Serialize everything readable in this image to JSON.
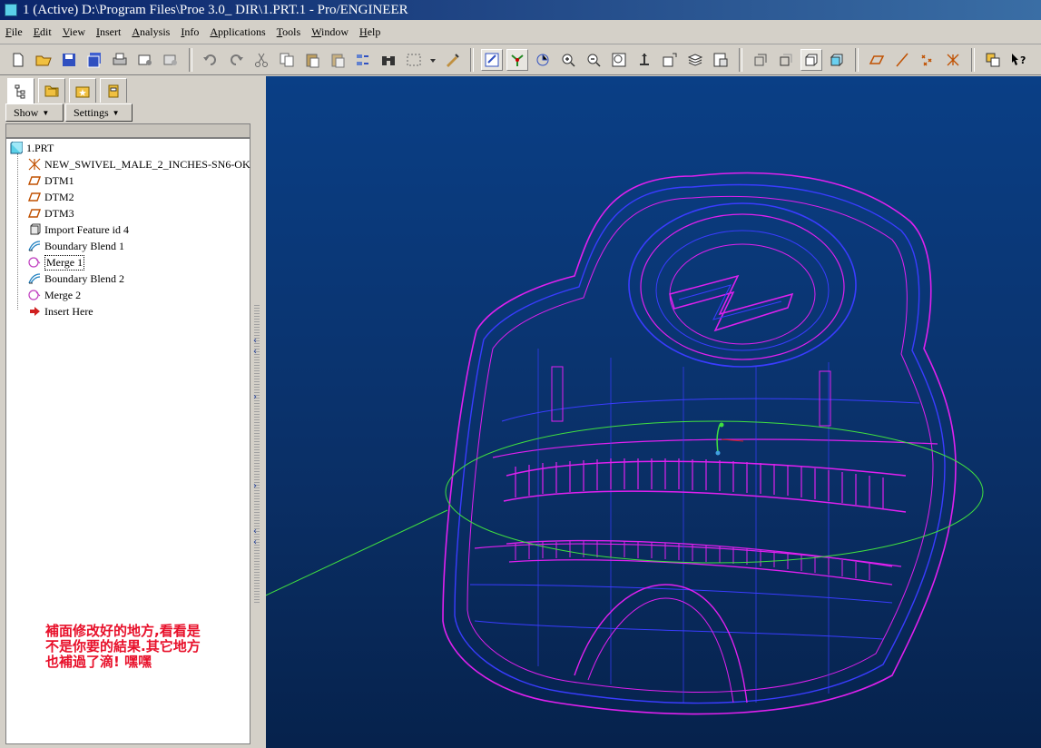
{
  "window": {
    "title": "1 (Active) D:\\Program Files\\Proe 3.0_ DIR\\1.PRT.1 - Pro/ENGINEER"
  },
  "menu": [
    {
      "first": "F",
      "rest": "ile"
    },
    {
      "first": "E",
      "rest": "dit"
    },
    {
      "first": "V",
      "rest": "iew"
    },
    {
      "first": "I",
      "rest": "nsert"
    },
    {
      "first": "A",
      "rest": "nalysis"
    },
    {
      "first": "I",
      "rest": "nfo"
    },
    {
      "first": "A",
      "rest": "pplications"
    },
    {
      "first": "T",
      "rest": "ools"
    },
    {
      "first": "W",
      "rest": "indow"
    },
    {
      "first": "H",
      "rest": "elp"
    }
  ],
  "panel": {
    "show_label": "Show",
    "settings_label": "Settings",
    "tree_items": [
      {
        "label": "1.PRT",
        "icon": "part-icon"
      },
      {
        "label": "NEW_SWIVEL_MALE_2_INCHES-SN6-OK",
        "icon": "csys-icon"
      },
      {
        "label": "DTM1",
        "icon": "datum-plane-icon"
      },
      {
        "label": "DTM2",
        "icon": "datum-plane-icon"
      },
      {
        "label": "DTM3",
        "icon": "datum-plane-icon"
      },
      {
        "label": "Import Feature id 4",
        "icon": "import-feature-icon"
      },
      {
        "label": "Boundary Blend 1",
        "icon": "boundary-blend-icon"
      },
      {
        "label": "Merge 1",
        "icon": "merge-icon"
      },
      {
        "label": "Boundary Blend 2",
        "icon": "boundary-blend-icon"
      },
      {
        "label": "Merge 2",
        "icon": "merge-icon"
      },
      {
        "label": "Insert Here",
        "icon": "insert-here-arrow-icon"
      }
    ]
  },
  "annotation": {
    "line1": "補面修改好的地方,看看是",
    "line2": "不是你要的結果.其它地方",
    "line3": "也補過了滴! 嘿嘿"
  },
  "colors": {
    "annotation": "#e8102a",
    "wire_blue": "#3a3cff",
    "wire_magenta": "#e020f0",
    "highlight_green": "#40e040"
  }
}
